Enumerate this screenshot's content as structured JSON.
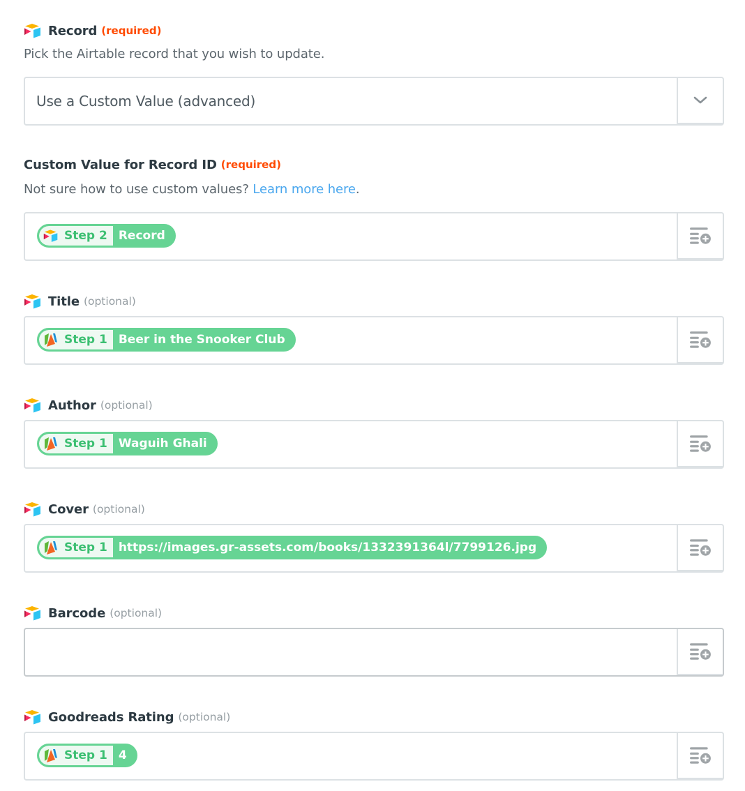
{
  "colors": {
    "required": "#ff4a00",
    "link": "#4aa7ee",
    "pill_green": "#66d494",
    "pill_step_text": "#3cbf72"
  },
  "record": {
    "label": "Record",
    "tag": "(required)",
    "help": "Pick the Airtable record that you wish to update.",
    "select_value": "Use a Custom Value (advanced)"
  },
  "custom_value": {
    "label": "Custom Value for Record ID",
    "tag": "(required)",
    "help_prefix": "Not sure how to use custom values?",
    "help_link": "Learn more here",
    "help_suffix": ".",
    "pill": {
      "step": "Step 2",
      "value": "Record",
      "source_icon": "airtable-icon"
    }
  },
  "fields": [
    {
      "label": "Title",
      "tag": "(optional)",
      "pill": {
        "step": "Step 1",
        "value": "Beer in the Snooker Club",
        "source_icon": "goodreads-app-icon"
      }
    },
    {
      "label": "Author",
      "tag": "(optional)",
      "pill": {
        "step": "Step 1",
        "value": "Waguih Ghali",
        "source_icon": "goodreads-app-icon"
      }
    },
    {
      "label": "Cover",
      "tag": "(optional)",
      "pill": {
        "step": "Step 1",
        "value": "https://images.gr-assets.com/books/1332391364l/7799126.jpg",
        "source_icon": "goodreads-app-icon"
      }
    },
    {
      "label": "Barcode",
      "tag": "(optional)",
      "value": ""
    },
    {
      "label": "Goodreads Rating",
      "tag": "(optional)",
      "pill": {
        "step": "Step 1",
        "value": "4",
        "source_icon": "goodreads-app-icon"
      }
    }
  ],
  "icons": {
    "field_app": "airtable-icon",
    "insert_data": "insert-data-icon",
    "dropdown": "chevron-down-icon"
  }
}
